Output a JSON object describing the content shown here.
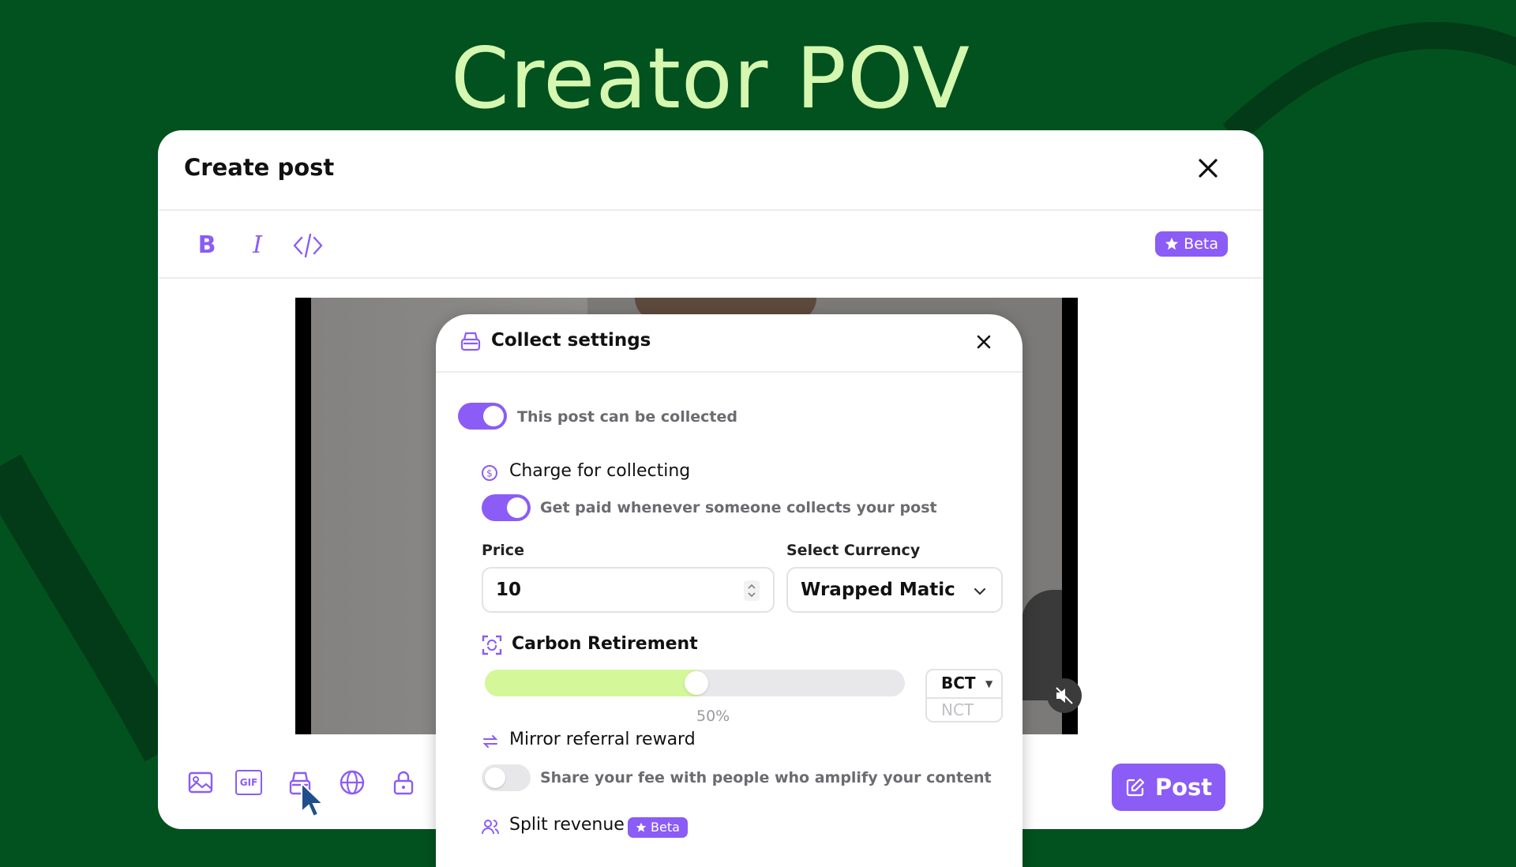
{
  "slide": {
    "title": "Creator POV"
  },
  "create_post": {
    "title": "Create post",
    "toolbar": {
      "bold": "B",
      "italic": "I",
      "beta": "Beta"
    },
    "post_button": "Post",
    "bottom_icons": [
      "image-icon",
      "gif-icon",
      "collect-icon",
      "globe-icon",
      "lock-icon"
    ],
    "gif_label": "GIF"
  },
  "collect_settings": {
    "title": "Collect settings",
    "collectable": {
      "label": "This post can be collected",
      "on": true
    },
    "charge": {
      "title": "Charge for collecting",
      "toggle_label": "Get paid whenever someone collects your post",
      "on": true
    },
    "price": {
      "label": "Price",
      "value": "10"
    },
    "currency": {
      "label": "Select Currency",
      "value": "Wrapped Matic"
    },
    "carbon": {
      "title": "Carbon Retirement",
      "percent": 50,
      "percent_label": "50%",
      "tokens": [
        "BCT",
        "NCT"
      ],
      "selected_token": "BCT"
    },
    "mirror": {
      "title": "Mirror referral reward",
      "toggle_label": "Share your fee with people who amplify your content",
      "on": false
    },
    "split": {
      "title": "Split revenue",
      "beta": "Beta"
    }
  },
  "colors": {
    "background": "#02521f",
    "accent": "#8b5cf6",
    "slider_fill": "#d4f79a",
    "title_text": "#d6f7b0"
  }
}
